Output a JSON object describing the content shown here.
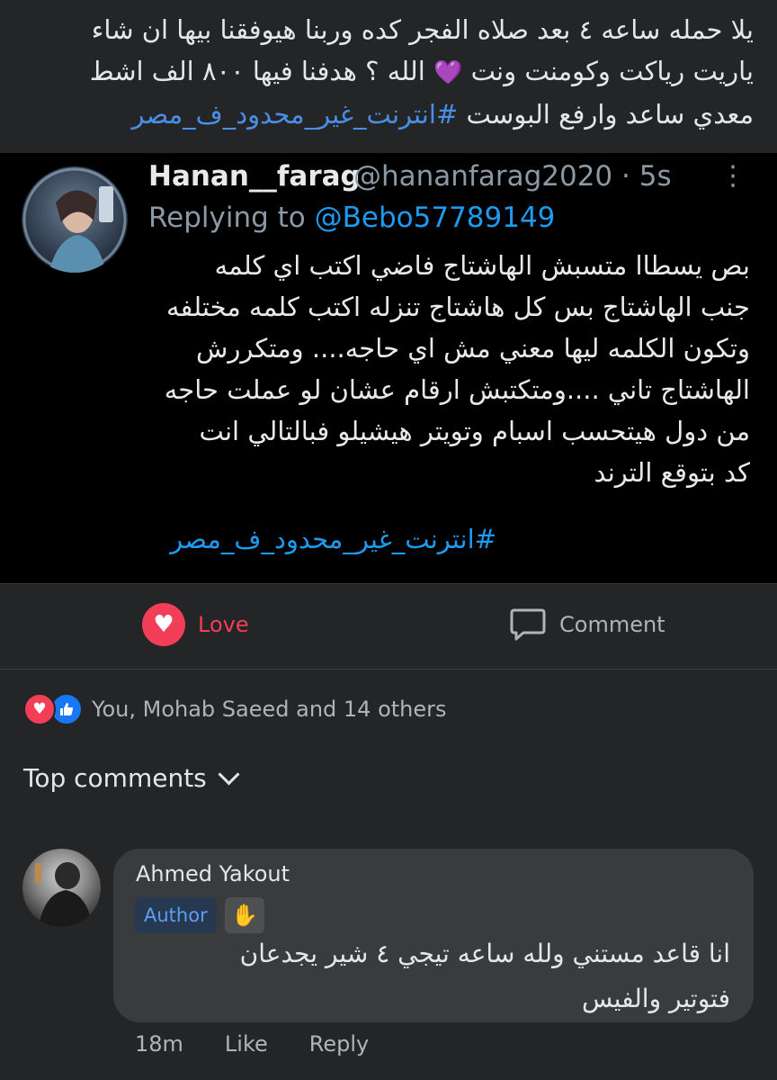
{
  "post": {
    "line1": "يلا حمله ساعه ٤ بعد صلاه الفجر كده وربنا هيوفقنا بيها ان شاء",
    "line2_a": "الله ؟ هدفنا فيها ٨٠٠ الف اشط",
    "line2_emoji": "💜",
    "line2_b": "ياريت رياكت وكومنت ونت",
    "line3_text": "معدي ساعد وارفع البوست",
    "line3_hashtag": "#انترنت_غير_محدود_ف_مصر"
  },
  "tweet": {
    "name": "Hanan__farag",
    "handle": "@hananfarag2020 · 5s",
    "more": "⋮",
    "replying_label": "Replying to",
    "replying_mention": "@Bebo57789149",
    "body": [
      "بص يسطاا متسبش الهاشتاج فاضي  اكتب اي كلمه",
      "جنب الهاشتاج بس كل هاشتاج تنزله اكتب كلمه مختلفه",
      "وتكون الكلمه ليها معني مش اي حاجه.... ومتكررش",
      "الهاشتاج تاني ....ومتكتبش ارقام عشان لو عملت حاجه",
      "من دول  هيتحسب اسبام وتويتر هيشيلو فبالتالي انت",
      "كد بتوقع الترند"
    ],
    "hashtag": "#انترنت_غير_محدود_ف_مصر"
  },
  "actions": {
    "love_label": "Love",
    "comment_label": "Comment",
    "love_color": "#f33e58"
  },
  "reactions": {
    "summary": "You, Mohab Saeed and 14 others"
  },
  "top_comments": {
    "label": "Top comments"
  },
  "comment": {
    "author": "Ahmed Yakout",
    "badge": "Author",
    "line1": "انا قاعد مستني ولله ساعه تيجي ٤ شير يجدعان",
    "line2": "فتوتير والفيس",
    "time": "18m",
    "like_label": "Like",
    "reply_label": "Reply"
  }
}
